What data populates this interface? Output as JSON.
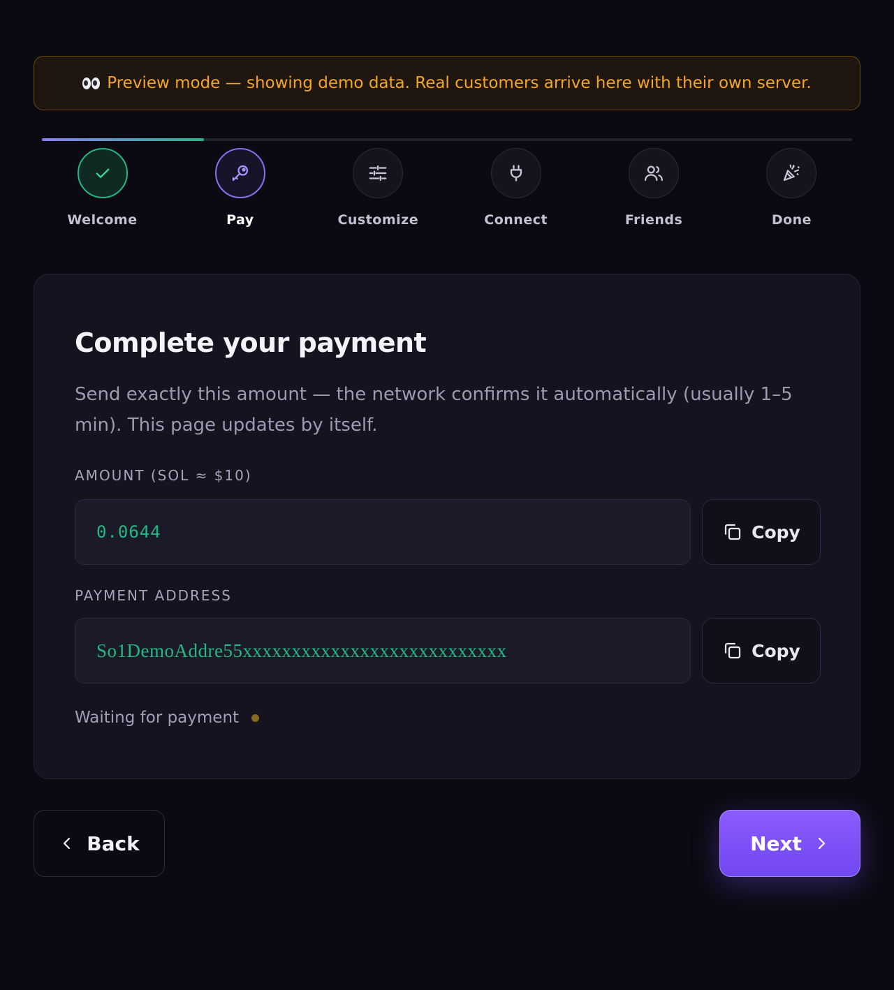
{
  "banner": {
    "icon": "eyes-icon",
    "text": "Preview mode — showing demo data. Real customers arrive here with their own server.",
    "color": "#f5a524"
  },
  "stepper": {
    "progress_fraction": 0.2,
    "current_step": 1,
    "steps": [
      {
        "label": "Welcome",
        "icon": "check-icon",
        "state": "done"
      },
      {
        "label": "Pay",
        "icon": "key-icon",
        "state": "active"
      },
      {
        "label": "Customize",
        "icon": "sliders-icon",
        "state": "upcoming"
      },
      {
        "label": "Connect",
        "icon": "plug-icon",
        "state": "upcoming"
      },
      {
        "label": "Friends",
        "icon": "users-icon",
        "state": "upcoming"
      },
      {
        "label": "Done",
        "icon": "party-popper-icon",
        "state": "upcoming"
      }
    ]
  },
  "payment": {
    "title": "Complete your payment",
    "description": "Send exactly this amount — the network confirms it automatically (usually 1–5 min). This page updates by itself.",
    "amount_label": "AMOUNT (SOL ≈ $10)",
    "amount_value": "0.0644",
    "address_label": "PAYMENT ADDRESS",
    "address_value": "So1DemoAddre55xxxxxxxxxxxxxxxxxxxxxxxxxxx",
    "copy_label": "Copy",
    "status_text": "Waiting for payment",
    "accent_green": "#24b882"
  },
  "nav": {
    "back_label": "Back",
    "next_label": "Next",
    "accent_purple": "#7c52f8"
  }
}
